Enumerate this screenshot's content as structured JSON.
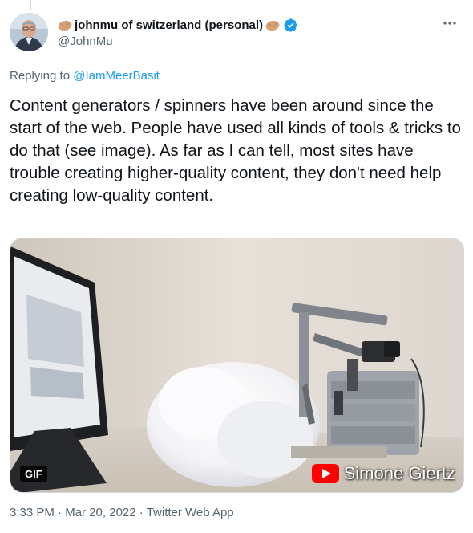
{
  "author": {
    "display_name": "johnmu of switzerland (personal)",
    "handle": "@JohnMu",
    "verified": true,
    "name_emoji": "potato"
  },
  "reply_context": {
    "prefix": "Replying to",
    "target": "@IamMeerBasit"
  },
  "tweet": {
    "text": "Content generators / spinners have been around since the start of the web. People have used all kinds of tools & tricks to do that (see image). As far as I can tell, most sites have trouble creating higher-quality content, they don't need help creating low-quality content."
  },
  "media": {
    "type": "gif",
    "badge": "GIF",
    "watermark": "Simone Giertz"
  },
  "meta": {
    "time": "3:33 PM",
    "separator": "·",
    "date": "Mar 20, 2022",
    "source": "Twitter Web App"
  },
  "colors": {
    "link": "#1d9bf0",
    "secondary_text": "#536471",
    "verified_badge": "#1d9bf0",
    "youtube_red": "#ff0000"
  },
  "icons": {
    "more": "more-options-icon",
    "verified": "verified-badge-icon",
    "emoji": "potato-emoji-icon",
    "youtube": "youtube-logo-icon"
  }
}
